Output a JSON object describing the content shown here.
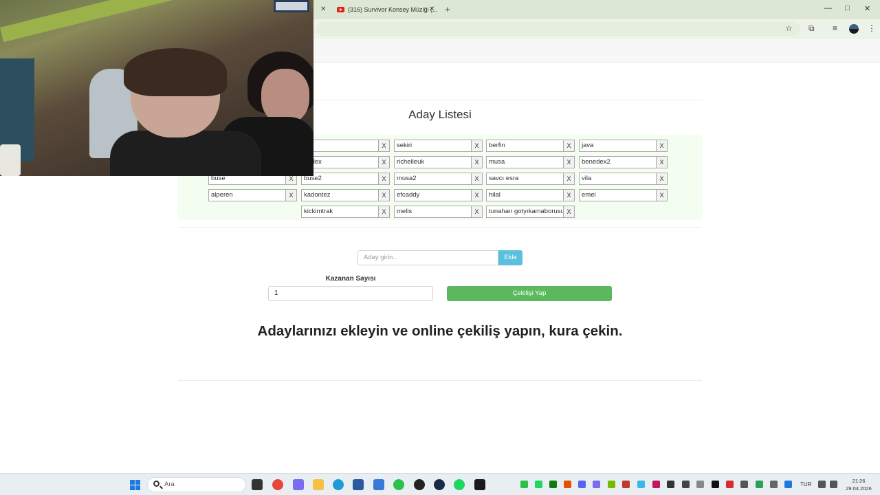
{
  "browser": {
    "tabs": [
      {
        "title": "(316) Survivor Konsey Müziği (..."
      }
    ],
    "new_tab_label": "+",
    "window_controls": {
      "minimize": "—",
      "maximize": "□",
      "close": "✕"
    },
    "toolbar_icons": [
      "star-icon",
      "extensions-icon",
      "media-icon",
      "profile-avatar",
      "menu-icon"
    ]
  },
  "page": {
    "title": "Aday Listesi",
    "candidates": [
      "05",
      "sekiri",
      "berfin",
      "java",
      "nedex",
      "richelieuk",
      "musa",
      "benedex2",
      "buse",
      "buse2",
      "musa2",
      "savcı esra",
      "vila",
      "alperen",
      "kadontez",
      "efcaddy",
      "hilal",
      "emel",
      "kickimtrak",
      "melis",
      "tunahan gotyıkamaborusu"
    ],
    "remove_label": "X",
    "add_input": {
      "placeholder": "Aday girin..."
    },
    "add_button": "Ekle",
    "winners_label": "Kazanan Sayısı",
    "winners_value": "1",
    "draw_button": "Çekilişi Yap",
    "headline": "Adaylarınızı ekleyin ve online çekiliş yapın, kura çekin."
  },
  "taskbar": {
    "search_placeholder": "Ara",
    "language": "TUR",
    "time": "21:26",
    "date": "29.04.2026",
    "pinned_apps": [
      "file-icon",
      "chrome-icon",
      "copilot-icon",
      "folder-icon",
      "edge-icon",
      "store-icon",
      "app-icon",
      "whatsapp-icon",
      "app2-icon",
      "steam-icon",
      "spotify-icon",
      "kick-icon"
    ]
  }
}
